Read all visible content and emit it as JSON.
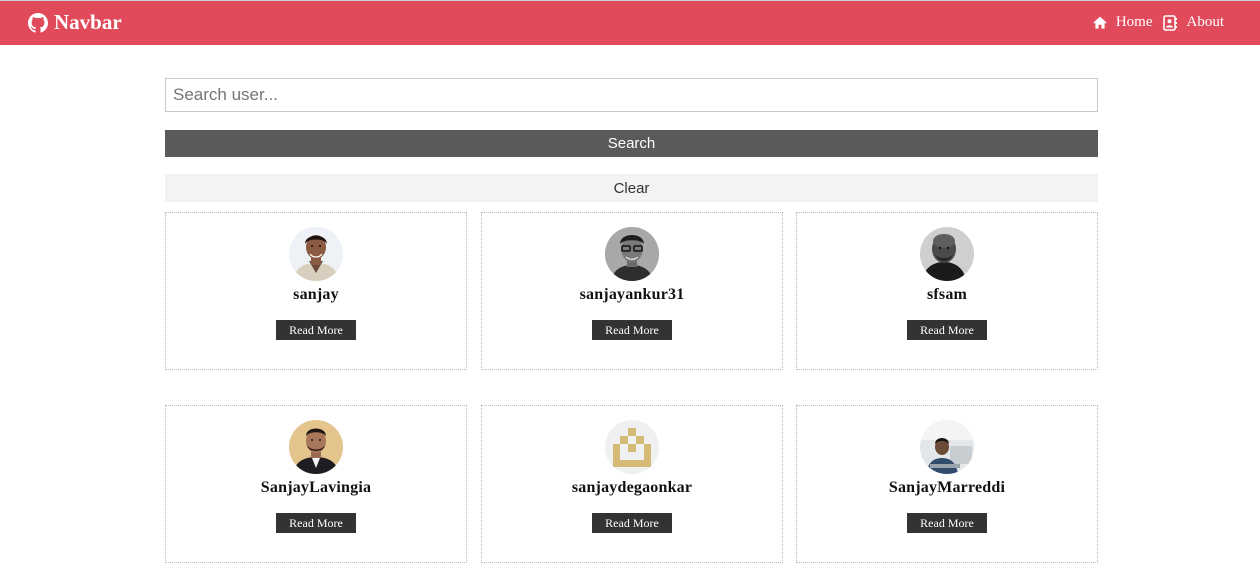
{
  "navbar": {
    "brand": "Navbar",
    "brand_icon": "github-icon",
    "links": [
      {
        "label": "Home",
        "icon": "home-icon"
      },
      {
        "label": "About",
        "icon": "contact-card-icon"
      }
    ],
    "background": "#e14a5b"
  },
  "search": {
    "placeholder": "Search user...",
    "value": "",
    "search_label": "Search",
    "clear_label": "Clear"
  },
  "users": [
    {
      "login": "sanjay",
      "button": "Read More"
    },
    {
      "login": "sanjayankur31",
      "button": "Read More"
    },
    {
      "login": "sfsam",
      "button": "Read More"
    },
    {
      "login": "SanjayLavingia",
      "button": "Read More"
    },
    {
      "login": "sanjaydegaonkar",
      "button": "Read More"
    },
    {
      "login": "SanjayMarreddi",
      "button": "Read More"
    }
  ]
}
